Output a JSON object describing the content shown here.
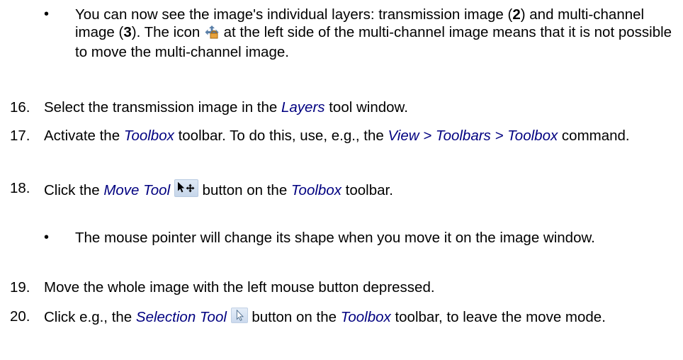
{
  "bullet_1": {
    "dot": "•",
    "part_a": "You can now see the image's individual layers: transmission image (",
    "num_2": "2",
    "part_b": ") and multi-channel image (",
    "num_3": "3",
    "part_c": "). The icon ",
    "icon": "layer-lock-icon",
    "part_d": " at the left side of the multi-channel image means that it is not possible to move the multi-channel image."
  },
  "step_16": {
    "number": "16.",
    "text_a": "Select the transmission image in the ",
    "ui_layers": "Layers",
    "text_b": " tool window."
  },
  "step_17": {
    "number": "17.",
    "text_a": "Activate the ",
    "ui_toolbox": "Toolbox",
    "text_b": " toolbar. To do this, use, e.g., the ",
    "ui_command": "View > Toolbars > Toolbox",
    "text_c": " command."
  },
  "step_18": {
    "number": "18.",
    "text_a": "Click the ",
    "ui_move_tool": "Move Tool",
    "icon": "move-tool-icon",
    "text_b": " button on the ",
    "ui_toolbox": "Toolbox",
    "text_c": " toolbar."
  },
  "bullet_2": {
    "dot": "•",
    "text": "The mouse pointer will change its shape when you move it on the image window."
  },
  "step_19": {
    "number": "19.",
    "text": "Move the whole image with the left mouse button depressed."
  },
  "step_20": {
    "number": "20.",
    "text_a": "Click e.g., the ",
    "ui_selection_tool": "Selection Tool",
    "icon": "selection-tool-icon",
    "text_b": " button on the ",
    "ui_toolbox": "Toolbox",
    "text_c": " toolbar, to leave the move mode."
  },
  "colors": {
    "ui_reference": "#000080",
    "text": "#000000",
    "background": "#ffffff"
  }
}
